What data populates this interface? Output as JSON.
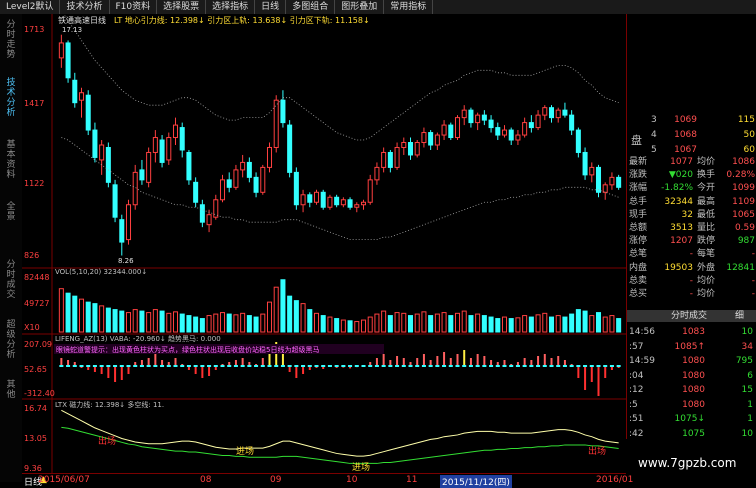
{
  "toolbar": {
    "items": [
      "Level2默认",
      "技术分析",
      "F10资料",
      "选择股票",
      "选择指标",
      "日线",
      "多图组合",
      "图形叠加",
      "常用指标"
    ]
  },
  "sidebar": {
    "tabs": [
      "分时走势",
      "技术分析",
      "基本资料",
      "全景",
      "分时成交",
      "超级分析",
      "其他"
    ]
  },
  "chart_header": {
    "stock": "铁通高速日线",
    "indicator": "LT 地心引力线: 12.398↓ 引力区上轨: 13.638↓ 引力区下轨: 11.158↓"
  },
  "price_axis": [
    "1713",
    "1417",
    "1122",
    "826"
  ],
  "price_marks": {
    "high": "17.13",
    "low": "8.26"
  },
  "volume_panel": {
    "header": "VOL(5,10,20) 32344.000↓",
    "axis": [
      "82448",
      "49727",
      "X10"
    ]
  },
  "macd_panel": {
    "header": "LIFENG_AZ(13) VABA: -20.960↓ 趋势黑马: 0.000",
    "note": "眼镜蛇道警提示：出现黄色柱状为买点，绿色柱状出现后收盘价站稳5日线为超级黑马",
    "axis": [
      "207.09",
      "52.65",
      "-312.40"
    ]
  },
  "gravity_panel": {
    "header": "LTX 磁力线: 12.398↓ 多空线: 11.",
    "axis": [
      "16.74",
      "13.05",
      "9.36"
    ],
    "labels": [
      {
        "text": "出场"
      },
      {
        "text": "进场"
      },
      {
        "text": "进场"
      },
      {
        "text": "出场"
      }
    ]
  },
  "date_axis": [
    "2015/06/07",
    "08",
    "09",
    "10",
    "11",
    "2015/11/12(四)",
    "2016/01"
  ],
  "bottom_tab": "日线",
  "quote": {
    "book": [
      {
        "level": "3",
        "price": "1069",
        "vol": "115"
      },
      {
        "level": "4",
        "price": "1068",
        "vol": "50"
      },
      {
        "level": "5",
        "price": "1067",
        "vol": "60"
      }
    ],
    "book_label": "盘",
    "stats": [
      {
        "l1": "最新",
        "v1": "1077",
        "l2": "均价",
        "v2": "1086"
      },
      {
        "l1": "涨跌",
        "v1": "▼020",
        "l2": "换手",
        "v2": "0.28%"
      },
      {
        "l1": "涨幅",
        "v1": "-1.82%",
        "l2": "今开",
        "v2": "1099"
      },
      {
        "l1": "总手",
        "v1": "32344",
        "l2": "最高",
        "v2": "1109"
      },
      {
        "l1": "现手",
        "v1": "32",
        "l2": "最低",
        "v2": "1065"
      },
      {
        "l1": "总额",
        "v1": "3513",
        "l2": "量比",
        "v2": "0.59"
      },
      {
        "l1": "涨停",
        "v1": "1207",
        "l2": "跌停",
        "v2": "987"
      },
      {
        "l1": "总笔",
        "v1": "-",
        "l2": "每笔",
        "v2": "-"
      },
      {
        "l1": "内盘",
        "v1": "19503",
        "l2": "外盘",
        "v2": "12841"
      },
      {
        "l1": "总卖",
        "v1": "-",
        "l2": "均价",
        "v2": "-"
      },
      {
        "l1": "总买",
        "v1": "-",
        "l2": "均价",
        "v2": "-"
      }
    ],
    "ticks_header": "分时成交",
    "ticks_btn": "细",
    "ticks": [
      {
        "time": "14:56",
        "price": "1083",
        "vol": "10"
      },
      {
        "time": ":57",
        "price": "1085↑",
        "vol": "34"
      },
      {
        "time": "14:59",
        "price": "1080",
        "vol": "795"
      },
      {
        "time": ":04",
        "price": "1080",
        "vol": "6"
      },
      {
        "time": ":12",
        "price": "1080",
        "vol": "15"
      },
      {
        "time": ":5",
        "price": "1080",
        "vol": "1"
      },
      {
        "time": ":51",
        "price": "1075↓",
        "vol": "1"
      },
      {
        "time": ":42",
        "price": "1075",
        "vol": "10"
      }
    ]
  },
  "watermark": "www.7gpzb.com",
  "chart_data": {
    "type": "candlestick",
    "ylim": [
      8.26,
      17.13
    ],
    "candles": [
      [
        16.2,
        17.13,
        15.8,
        16.8
      ],
      [
        16.8,
        16.9,
        15.2,
        15.4
      ],
      [
        15.3,
        15.6,
        14.2,
        14.4
      ],
      [
        14.5,
        15.0,
        13.8,
        14.8
      ],
      [
        14.7,
        14.9,
        13.1,
        13.3
      ],
      [
        13.3,
        13.6,
        12.0,
        12.2
      ],
      [
        12.1,
        12.9,
        11.5,
        12.7
      ],
      [
        12.6,
        12.8,
        11.0,
        11.2
      ],
      [
        11.1,
        11.3,
        9.6,
        9.8
      ],
      [
        9.7,
        9.9,
        8.26,
        8.8
      ],
      [
        8.9,
        10.5,
        8.7,
        10.3
      ],
      [
        10.3,
        11.9,
        10.1,
        11.6
      ],
      [
        11.7,
        12.1,
        11.1,
        11.3
      ],
      [
        11.2,
        12.6,
        11.0,
        12.4
      ],
      [
        12.4,
        13.3,
        12.0,
        13.0
      ],
      [
        12.9,
        13.1,
        11.8,
        12.0
      ],
      [
        12.1,
        13.2,
        11.9,
        13.0
      ],
      [
        13.0,
        13.8,
        12.7,
        13.5
      ],
      [
        13.4,
        13.6,
        12.2,
        12.5
      ],
      [
        12.4,
        12.5,
        11.1,
        11.3
      ],
      [
        11.2,
        11.4,
        10.2,
        10.4
      ],
      [
        10.3,
        10.5,
        9.4,
        9.6
      ],
      [
        9.5,
        10.1,
        9.2,
        9.9
      ],
      [
        9.8,
        10.7,
        9.7,
        10.5
      ],
      [
        10.5,
        11.5,
        10.4,
        11.3
      ],
      [
        11.3,
        11.6,
        10.8,
        11.0
      ],
      [
        11.0,
        11.9,
        10.9,
        11.7
      ],
      [
        11.7,
        12.3,
        11.4,
        12.0
      ],
      [
        12.0,
        12.2,
        11.2,
        11.4
      ],
      [
        11.4,
        11.6,
        10.6,
        10.8
      ],
      [
        10.8,
        11.9,
        10.7,
        11.8
      ],
      [
        11.8,
        12.8,
        11.6,
        12.6
      ],
      [
        12.6,
        14.7,
        12.4,
        14.5
      ],
      [
        14.5,
        14.9,
        13.4,
        13.6
      ],
      [
        13.5,
        13.7,
        11.4,
        11.6
      ],
      [
        11.6,
        11.8,
        10.1,
        10.3
      ],
      [
        10.3,
        10.9,
        10.0,
        10.7
      ],
      [
        10.7,
        10.8,
        10.2,
        10.4
      ],
      [
        10.4,
        10.9,
        10.3,
        10.8
      ],
      [
        10.8,
        10.9,
        10.1,
        10.2
      ],
      [
        10.2,
        10.7,
        10.1,
        10.6
      ],
      [
        10.6,
        10.7,
        10.2,
        10.3
      ],
      [
        10.3,
        10.6,
        10.2,
        10.5
      ],
      [
        10.5,
        10.6,
        10.1,
        10.2
      ],
      [
        10.2,
        10.4,
        10.0,
        10.3
      ],
      [
        10.3,
        10.5,
        10.1,
        10.4
      ],
      [
        10.4,
        11.5,
        10.3,
        11.3
      ],
      [
        11.3,
        12.0,
        11.1,
        11.8
      ],
      [
        11.8,
        12.6,
        11.6,
        12.4
      ],
      [
        12.4,
        12.5,
        11.6,
        11.8
      ],
      [
        11.8,
        12.8,
        11.7,
        12.6
      ],
      [
        12.6,
        13.0,
        12.3,
        12.8
      ],
      [
        12.8,
        13.0,
        12.1,
        12.3
      ],
      [
        12.3,
        12.9,
        12.2,
        12.8
      ],
      [
        12.8,
        13.4,
        12.6,
        13.2
      ],
      [
        13.2,
        13.3,
        12.5,
        12.7
      ],
      [
        12.7,
        13.2,
        12.5,
        13.1
      ],
      [
        13.1,
        13.7,
        12.9,
        13.5
      ],
      [
        13.5,
        13.6,
        12.9,
        13.0
      ],
      [
        13.0,
        13.9,
        12.9,
        13.8
      ],
      [
        13.8,
        14.3,
        13.5,
        14.1
      ],
      [
        14.1,
        14.2,
        13.4,
        13.6
      ],
      [
        13.6,
        14.0,
        13.3,
        13.9
      ],
      [
        13.9,
        14.1,
        13.5,
        13.7
      ],
      [
        13.7,
        13.9,
        13.2,
        13.4
      ],
      [
        13.4,
        13.6,
        12.9,
        13.1
      ],
      [
        13.1,
        13.5,
        13.0,
        13.3
      ],
      [
        13.3,
        13.4,
        12.7,
        12.9
      ],
      [
        12.9,
        13.3,
        12.7,
        13.1
      ],
      [
        13.1,
        13.8,
        13.0,
        13.6
      ],
      [
        13.6,
        13.9,
        13.2,
        13.4
      ],
      [
        13.4,
        14.1,
        13.3,
        13.9
      ],
      [
        13.9,
        14.3,
        13.7,
        14.2
      ],
      [
        14.2,
        14.3,
        13.6,
        13.8
      ],
      [
        13.8,
        14.2,
        13.6,
        14.1
      ],
      [
        14.1,
        14.4,
        13.8,
        13.9
      ],
      [
        13.9,
        14.1,
        13.1,
        13.3
      ],
      [
        13.3,
        13.4,
        12.2,
        12.4
      ],
      [
        12.4,
        12.6,
        11.3,
        11.5
      ],
      [
        11.5,
        12.0,
        11.2,
        11.8
      ],
      [
        11.8,
        11.9,
        10.6,
        10.8
      ],
      [
        10.8,
        11.2,
        10.5,
        11.1
      ],
      [
        11.1,
        11.6,
        10.9,
        11.4
      ],
      [
        11.4,
        11.5,
        10.9,
        11.0
      ]
    ],
    "volume": [
      58,
      52,
      48,
      44,
      40,
      38,
      35,
      32,
      30,
      28,
      26,
      30,
      28,
      26,
      30,
      28,
      25,
      27,
      24,
      22,
      20,
      18,
      22,
      24,
      26,
      24,
      23,
      25,
      22,
      20,
      24,
      40,
      60,
      70,
      48,
      42,
      38,
      30,
      25,
      22,
      20,
      18,
      16,
      15,
      14,
      16,
      20,
      24,
      28,
      22,
      26,
      25,
      22,
      24,
      27,
      22,
      24,
      26,
      22,
      25,
      28,
      22,
      24,
      22,
      20,
      18,
      20,
      18,
      19,
      22,
      20,
      23,
      25,
      20,
      22,
      20,
      24,
      30,
      28,
      22,
      26,
      20,
      22,
      18
    ],
    "macd": [
      40,
      30,
      20,
      -10,
      -20,
      -30,
      -40,
      -60,
      -80,
      -70,
      -40,
      20,
      30,
      40,
      60,
      30,
      20,
      40,
      10,
      -20,
      -40,
      -60,
      -50,
      -20,
      10,
      20,
      30,
      40,
      20,
      10,
      40,
      80,
      120,
      90,
      -30,
      -60,
      -40,
      -20,
      -10,
      -15,
      -5,
      -10,
      -8,
      -12,
      -6,
      -4,
      20,
      40,
      60,
      30,
      50,
      40,
      20,
      40,
      60,
      30,
      50,
      70,
      40,
      60,
      80,
      40,
      60,
      50,
      30,
      20,
      30,
      10,
      20,
      40,
      30,
      50,
      60,
      40,
      50,
      30,
      10,
      -60,
      -120,
      -80,
      -150,
      -60,
      -20,
      -10
    ],
    "gravity_line": [
      15.8,
      15.4,
      15.0,
      14.6,
      14.2,
      13.8,
      13.5,
      13.2,
      12.9,
      12.6,
      12.4,
      12.2,
      12.1,
      12.0,
      12.0,
      12.0,
      12.1,
      12.2,
      12.3,
      12.3,
      12.2,
      12.0,
      11.8,
      11.6,
      11.5,
      11.4,
      11.4,
      11.5,
      11.5,
      11.5,
      11.5,
      11.7,
      12.0,
      12.3,
      12.3,
      12.1,
      11.9,
      11.7,
      11.5,
      11.3,
      11.1,
      10.9,
      10.8,
      10.7,
      10.6,
      10.6,
      10.7,
      10.9,
      11.1,
      11.3,
      11.5,
      11.7,
      11.9,
      12.1,
      12.3,
      12.5,
      12.6,
      12.8,
      12.9,
      13.0,
      13.2,
      13.3,
      13.4,
      13.4,
      13.4,
      13.3,
      13.3,
      13.2,
      13.2,
      13.2,
      13.2,
      13.3,
      13.4,
      13.5,
      13.6,
      13.6,
      13.5,
      13.3,
      13.0,
      12.8,
      12.5,
      12.3,
      12.2,
      12.1
    ],
    "trend_line": [
      15.0,
      14.9,
      14.7,
      14.5,
      14.3,
      14.1,
      13.9,
      13.7,
      13.5,
      13.3,
      13.1,
      13.0,
      12.8,
      12.7,
      12.6,
      12.5,
      12.4,
      12.3,
      12.3,
      12.2,
      12.2,
      12.1,
      12.0,
      11.9,
      11.8,
      11.8,
      11.7,
      11.7,
      11.6,
      11.6,
      11.6,
      11.6,
      11.6,
      11.7,
      11.7,
      11.7,
      11.6,
      11.5,
      11.4,
      11.3,
      11.2,
      11.1,
      11.0,
      10.9,
      10.9,
      10.9,
      10.9,
      10.9,
      11.0,
      11.0,
      11.1,
      11.2,
      11.3,
      11.4,
      11.5,
      11.6,
      11.7,
      11.8,
      11.9,
      12.0,
      12.1,
      12.2,
      12.3,
      12.4,
      12.4,
      12.5,
      12.5,
      12.6,
      12.6,
      12.7,
      12.7,
      12.8,
      12.8,
      12.9,
      12.9,
      13.0,
      13.0,
      13.0,
      13.0,
      12.9,
      12.9,
      12.8,
      12.7,
      12.6
    ]
  }
}
